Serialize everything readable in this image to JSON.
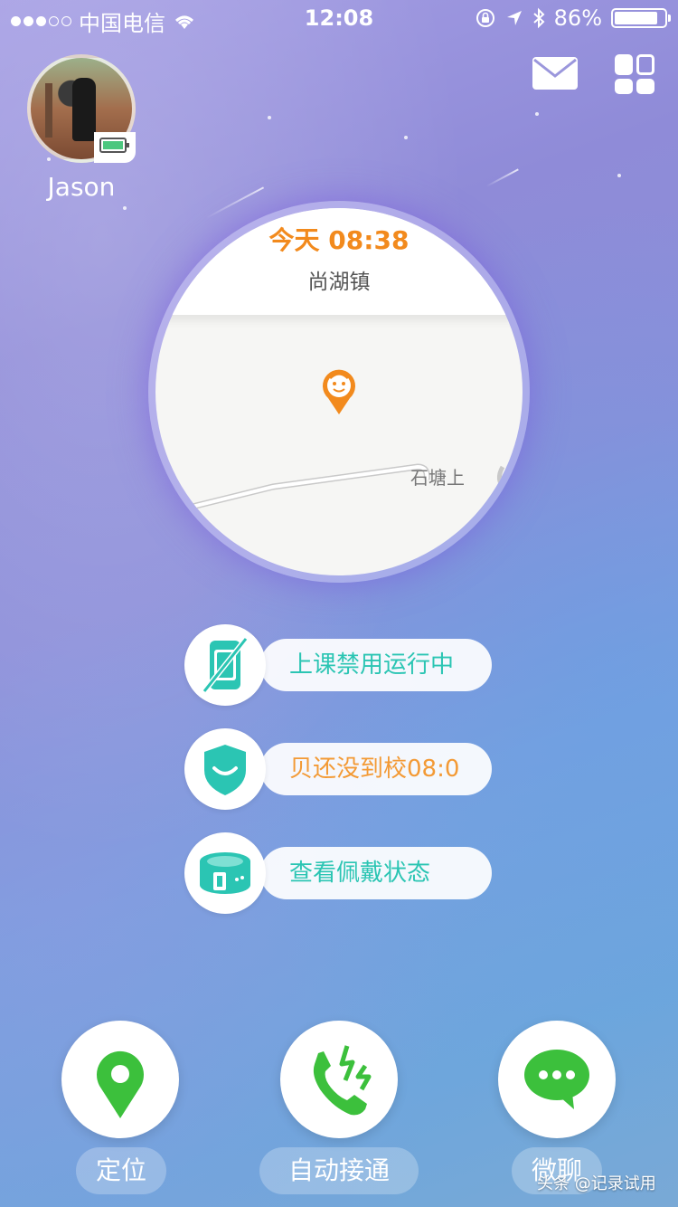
{
  "status_bar": {
    "carrier": "中国电信",
    "time": "12:08",
    "battery_percent": "86%"
  },
  "header": {
    "user_name": "Jason",
    "mail_icon": "mail-icon",
    "apps_icon": "grid-icon"
  },
  "map_card": {
    "time_label": "今天 08:38",
    "place": "尚湖镇",
    "road_label": "石塘上",
    "pin_icon": "child-face-pin-icon"
  },
  "features": [
    {
      "label": "上课禁用运行中",
      "icon": "watch-disabled-icon",
      "color": "#2bc5b3"
    },
    {
      "label": "贝还没到校08:0",
      "icon": "shield-smile-icon",
      "color": "#f39a35"
    },
    {
      "label": "查看佩戴状态",
      "icon": "wristband-icon",
      "color": "#2bc5b3"
    }
  ],
  "actions": [
    {
      "label": "定位",
      "icon": "location-pin-icon"
    },
    {
      "label": "自动接通",
      "icon": "phone-auto-answer-icon"
    },
    {
      "label": "微聊",
      "icon": "chat-bubble-icon"
    }
  ],
  "watermark": "头条 @记录试用",
  "colors": {
    "accent_orange": "#f28a1d",
    "teal": "#2bc5b3",
    "green": "#3cc03c"
  }
}
